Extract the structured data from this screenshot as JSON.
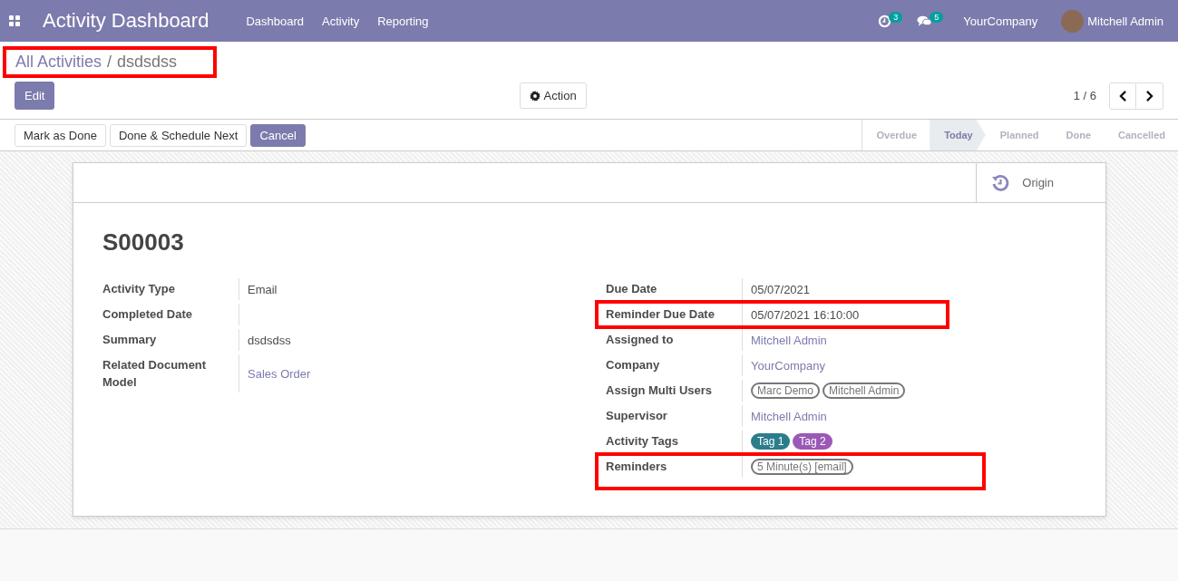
{
  "navbar": {
    "app_title": "Activity Dashboard",
    "menu": [
      "Dashboard",
      "Activity",
      "Reporting"
    ],
    "activity_count": "3",
    "message_count": "5",
    "company": "YourCompany",
    "user": "Mitchell Admin"
  },
  "breadcrumb": {
    "parent": "All Activities",
    "separator": "/",
    "current": "dsdsdss",
    "highlighted": true
  },
  "control_panel": {
    "edit_button": "Edit",
    "action_button": "Action",
    "pager": "1 / 6"
  },
  "status_bar": {
    "buttons": [
      {
        "label": "Mark as Done",
        "primary": false
      },
      {
        "label": "Done & Schedule Next",
        "primary": false
      },
      {
        "label": "Cancel",
        "primary": true
      }
    ],
    "stages": [
      {
        "label": "Overdue",
        "selected": false
      },
      {
        "label": "Today",
        "selected": true
      },
      {
        "label": "Planned",
        "selected": false
      },
      {
        "label": "Done",
        "selected": false
      },
      {
        "label": "Cancelled",
        "selected": false
      }
    ]
  },
  "sheet": {
    "smart_button": "Origin",
    "title": "S00003",
    "left_fields": [
      {
        "label": "Activity Type",
        "kind": "text",
        "value": "Email",
        "highlighted": false
      },
      {
        "label": "Completed Date",
        "kind": "text",
        "highlighted": false
      },
      {
        "label": "Summary",
        "kind": "text",
        "value": "dsdsdss",
        "highlighted": false
      },
      {
        "label": "Related Document Model",
        "kind": "link",
        "value": "Sales Order",
        "highlighted": false
      }
    ],
    "right_fields": [
      {
        "label": "Due Date",
        "kind": "text",
        "value": "05/07/2021",
        "highlighted": false
      },
      {
        "label": "Reminder Due Date",
        "kind": "text",
        "value": "05/07/2021 16:10:00",
        "highlighted": true
      },
      {
        "label": "Assigned to",
        "kind": "link",
        "value": "Mitchell Admin",
        "highlighted": false
      },
      {
        "label": "Company",
        "kind": "link",
        "value": "YourCompany",
        "highlighted": false
      },
      {
        "label": "Assign Multi Users",
        "kind": "tags",
        "tags": [
          {
            "label": "Marc Demo"
          },
          {
            "label": "Mitchell Admin"
          }
        ],
        "highlighted": false
      },
      {
        "label": "Supervisor",
        "kind": "link",
        "value": "Mitchell Admin",
        "highlighted": false
      },
      {
        "label": "Activity Tags",
        "kind": "tags",
        "tags": [
          {
            "label": "Tag 1",
            "color": "#2c7d8c"
          },
          {
            "label": "Tag 2",
            "color": "#9b59b6"
          }
        ],
        "highlighted": false
      },
      {
        "label": "Reminders",
        "kind": "tags",
        "tags": [
          {
            "label": "5 Minute(s) [email]"
          }
        ],
        "highlighted": true
      }
    ]
  }
}
